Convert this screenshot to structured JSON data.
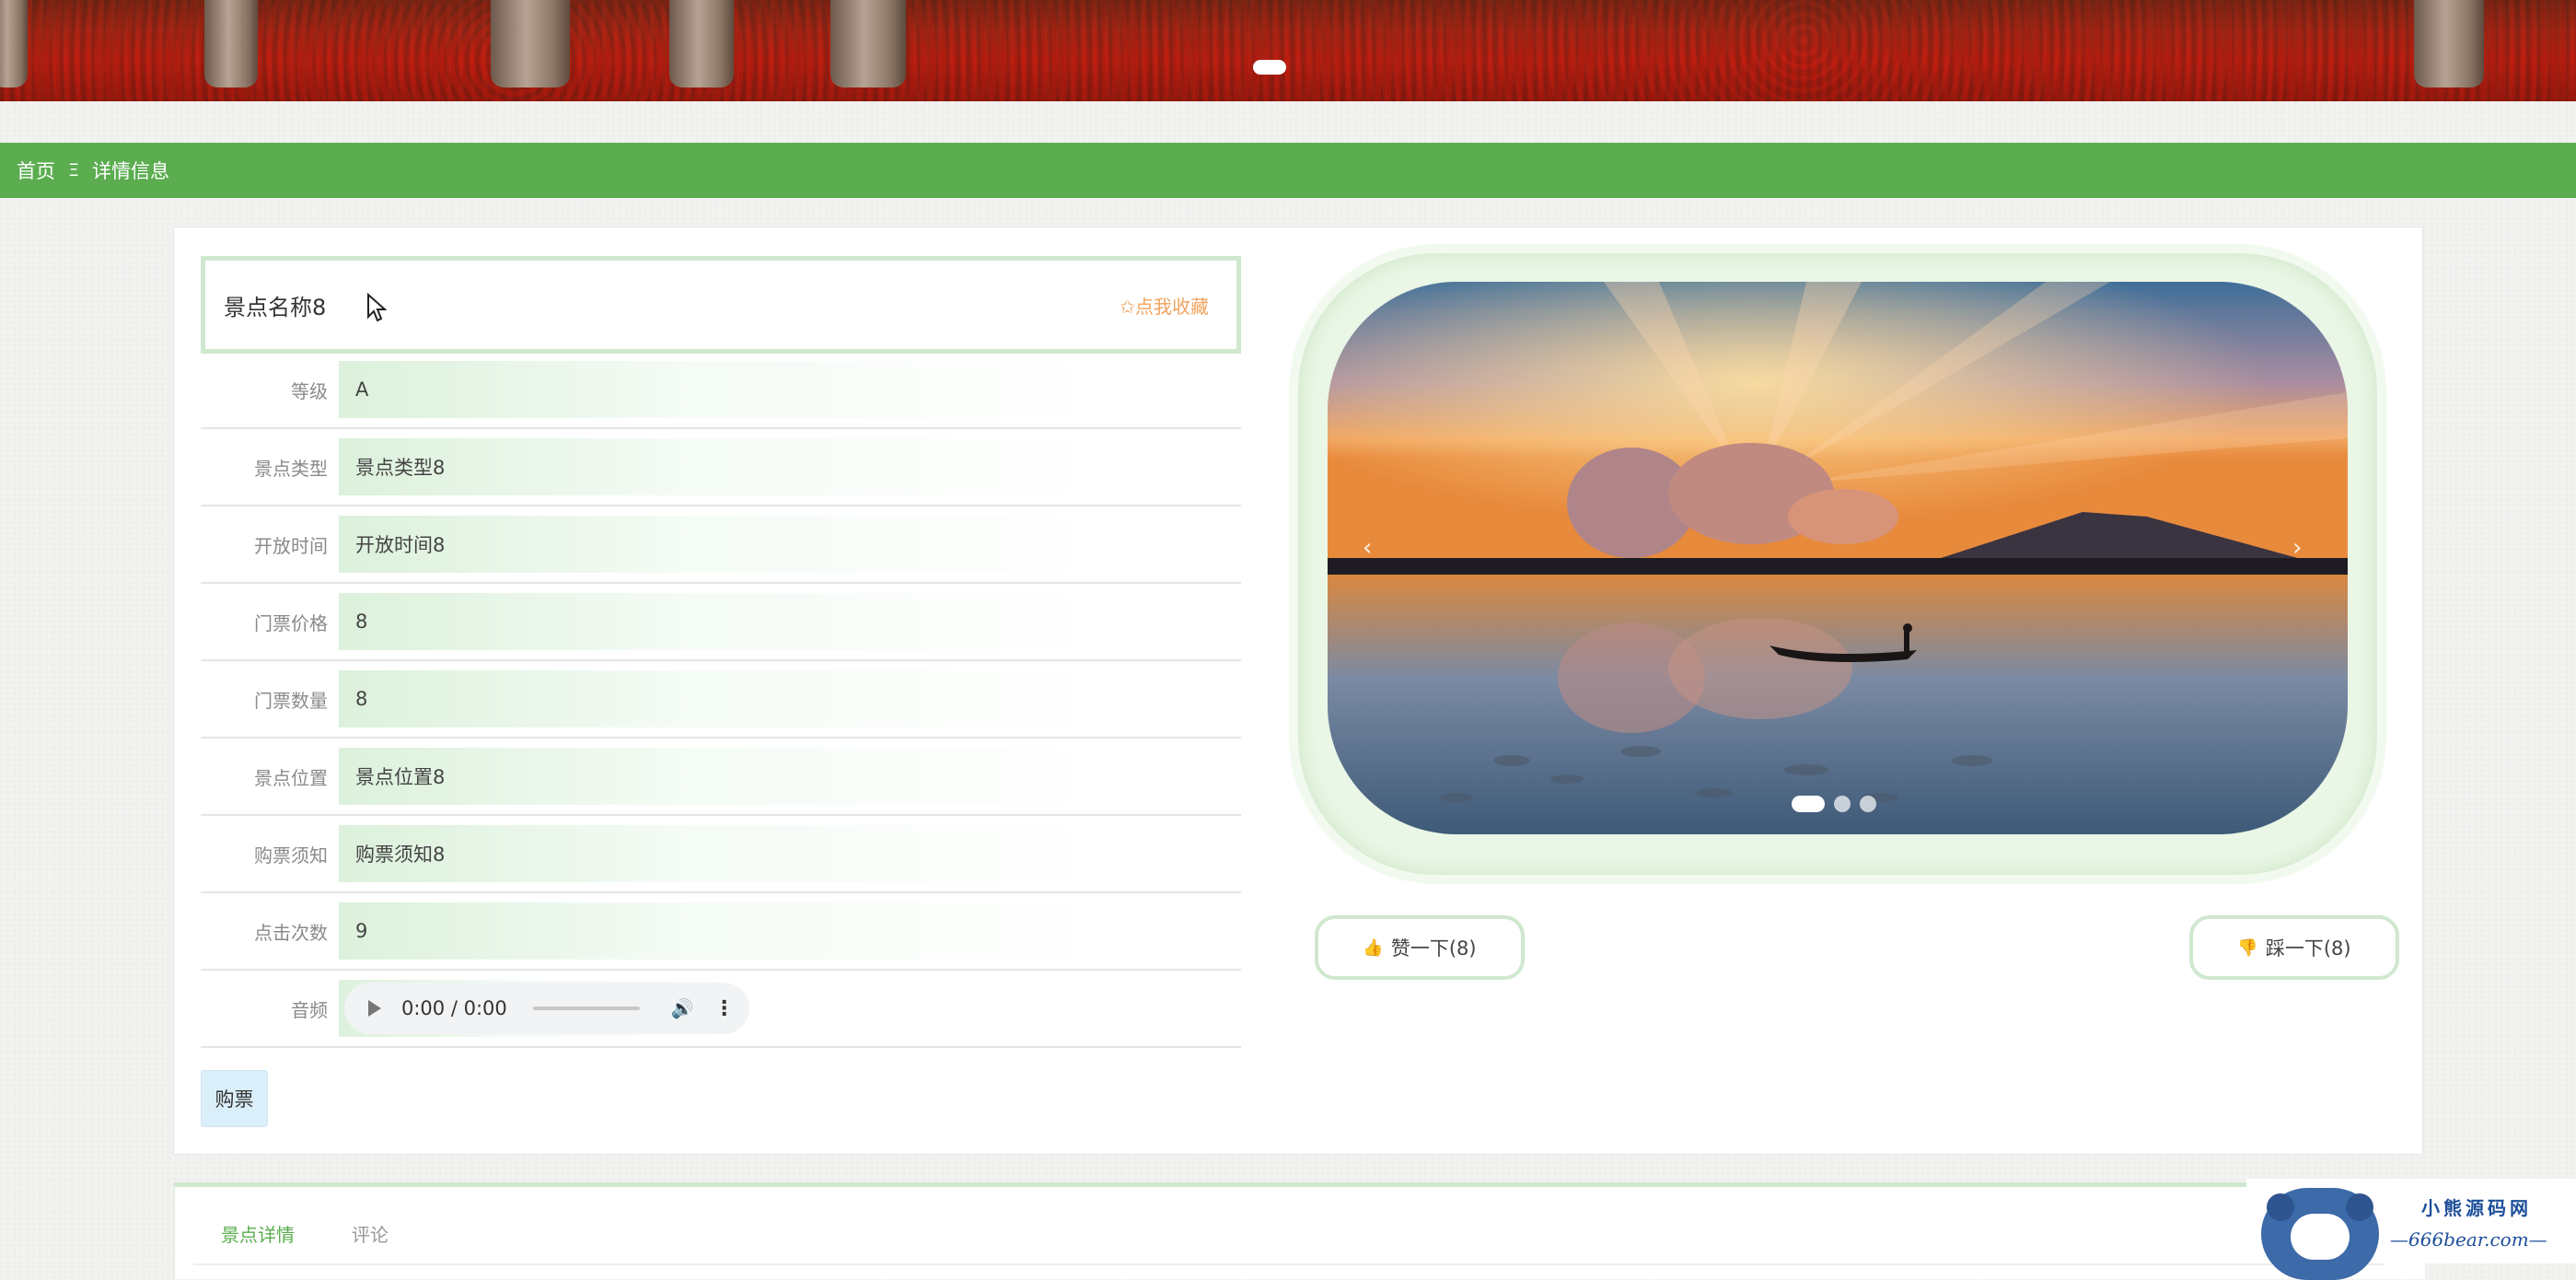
{
  "nav": {
    "home": "首页",
    "separator": "Ξ",
    "current": "详情信息"
  },
  "detail": {
    "name": "景点名称8",
    "favorite_label": "✩点我收藏",
    "fields": [
      {
        "label": "等级",
        "value": "A"
      },
      {
        "label": "景点类型",
        "value": "景点类型8"
      },
      {
        "label": "开放时间",
        "value": "开放时间8"
      },
      {
        "label": "门票价格",
        "value": "8"
      },
      {
        "label": "门票数量",
        "value": "8"
      },
      {
        "label": "景点位置",
        "value": "景点位置8"
      },
      {
        "label": "购票须知",
        "value": "购票须知8"
      },
      {
        "label": "点击次数",
        "value": "9"
      }
    ],
    "audio_label": "音频",
    "audio_time": "0:00 / 0:00",
    "buy_label": "购票"
  },
  "carousel": {
    "prev": "‹",
    "next": "›",
    "slide_count": 3,
    "active_slide": 1
  },
  "votes": {
    "like_label": "赞一下(8)",
    "dislike_label": "踩一下(8)"
  },
  "tabs": [
    {
      "label": "景点详情",
      "active": true
    },
    {
      "label": "评论",
      "active": false
    }
  ],
  "watermark": {
    "title": "小熊源码网",
    "url": "—666bear.com—"
  },
  "colors": {
    "nav_green": "#5bad50",
    "frame_green": "#cfe8cf",
    "favorite_orange": "#f0a35e",
    "buy_blue": "#dbeffa"
  },
  "icons": {
    "like": "thumbs-up-icon",
    "dislike": "thumbs-down-icon",
    "play": "play-icon",
    "volume": "volume-icon",
    "more": "more-vertical-icon"
  }
}
